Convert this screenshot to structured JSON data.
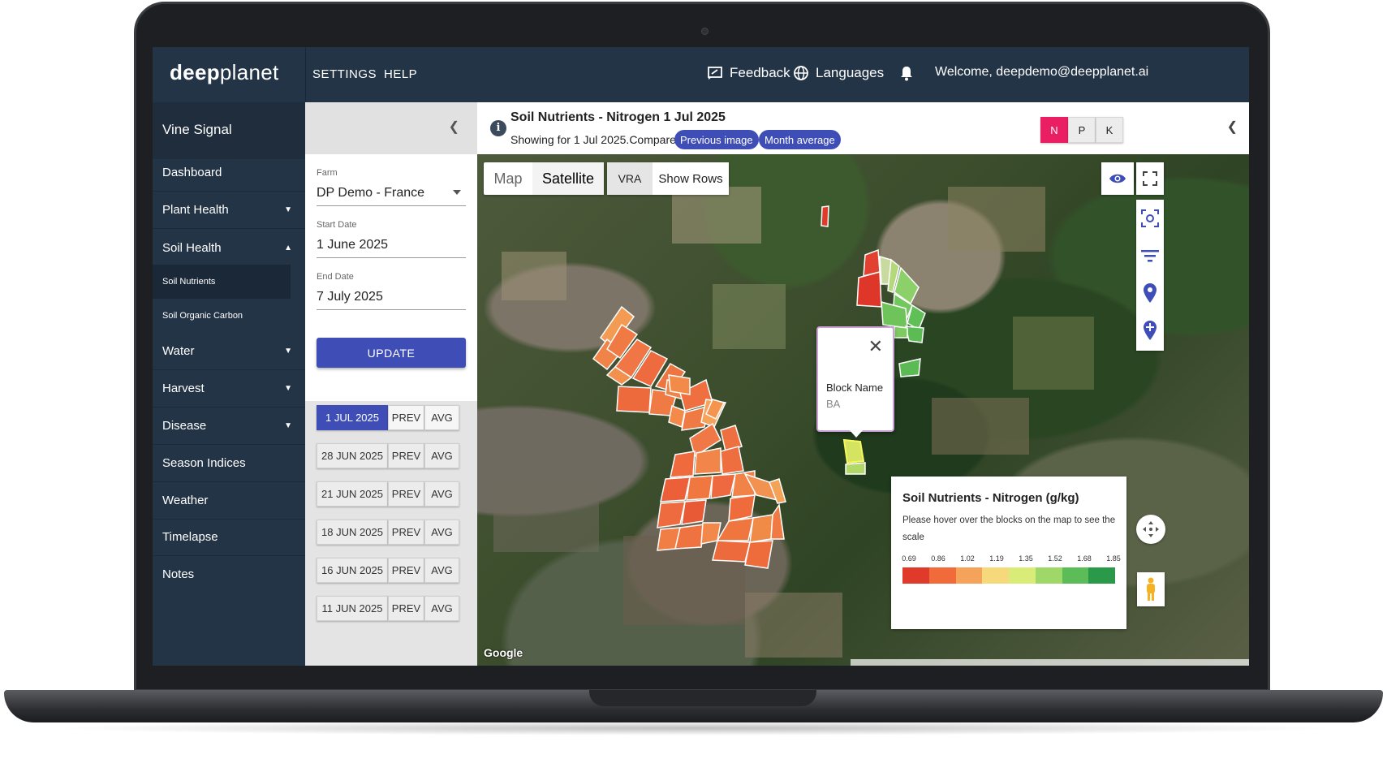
{
  "app": {
    "logo_bold": "deep",
    "logo_light": "planet"
  },
  "topnav": {
    "settings": "SETTINGS",
    "help": "HELP",
    "feedback": "Feedback",
    "languages": "Languages",
    "welcome": "Welcome, deepdemo@deepplanet.ai"
  },
  "sidebar": {
    "section_title": "Vine Signal",
    "items": [
      {
        "label": "Dashboard",
        "chevron": ""
      },
      {
        "label": "Plant Health",
        "chevron": "⌄"
      },
      {
        "label": "Soil Health",
        "chevron": "⌃"
      },
      {
        "label": "Water",
        "chevron": "⌄"
      },
      {
        "label": "Harvest",
        "chevron": "⌄"
      },
      {
        "label": "Disease",
        "chevron": "⌄"
      },
      {
        "label": "Season Indices",
        "chevron": ""
      },
      {
        "label": "Weather",
        "chevron": ""
      },
      {
        "label": "Timelapse",
        "chevron": ""
      },
      {
        "label": "Notes",
        "chevron": ""
      }
    ],
    "sub_items": [
      {
        "label": "Soil Nutrients",
        "active": true
      },
      {
        "label": "Soil Organic Carbon",
        "active": false
      }
    ]
  },
  "filters": {
    "farm_label": "Farm",
    "farm_value": "DP Demo - France",
    "start_label": "Start Date",
    "start_value": "1 June 2025",
    "end_label": "End Date",
    "end_value": "7 July 2025",
    "update_label": "UPDATE",
    "prev_label": "PREV",
    "avg_label": "AVG",
    "dates": [
      "1 JUL 2025",
      "28 JUN 2025",
      "21 JUN 2025",
      "18 JUN 2025",
      "16 JUN 2025",
      "11 JUN 2025"
    ],
    "selected_index": 0
  },
  "map_header": {
    "title": "Soil Nutrients - Nitrogen 1 Jul 2025",
    "subtitle": "Showing for 1 Jul 2025.Compare to",
    "prev_image": "Previous image",
    "month_average": "Month average",
    "nutrients": [
      "N",
      "P",
      "K"
    ],
    "selected_nutrient": "N",
    "accent_color": "#e91e63",
    "primary_color": "#3f4eb7"
  },
  "map": {
    "type_map": "Map",
    "type_satellite": "Satellite",
    "vra": "VRA",
    "show_rows": "Show Rows",
    "attribution": "Google",
    "popup": {
      "title": "Block Name",
      "value": "BA"
    },
    "tool_icons": [
      "eye-icon",
      "fullscreen-icon",
      "focus-icon",
      "filter-icon",
      "location-pin-icon",
      "add-pin-icon",
      "compass-icon",
      "pegman-icon"
    ]
  },
  "legend": {
    "title": "Soil Nutrients - Nitrogen (g/kg)",
    "subtitle": "Please hover over the blocks on the map to see the scale",
    "ticks": [
      "0.69",
      "0.86",
      "1.02",
      "1.19",
      "1.35",
      "1.52",
      "1.68",
      "1.85"
    ],
    "colors": [
      "#e03a2a",
      "#f06a3a",
      "#f5a25a",
      "#f6d97a",
      "#d9ec78",
      "#9fd768",
      "#5cbc58",
      "#2a9a4a"
    ]
  }
}
